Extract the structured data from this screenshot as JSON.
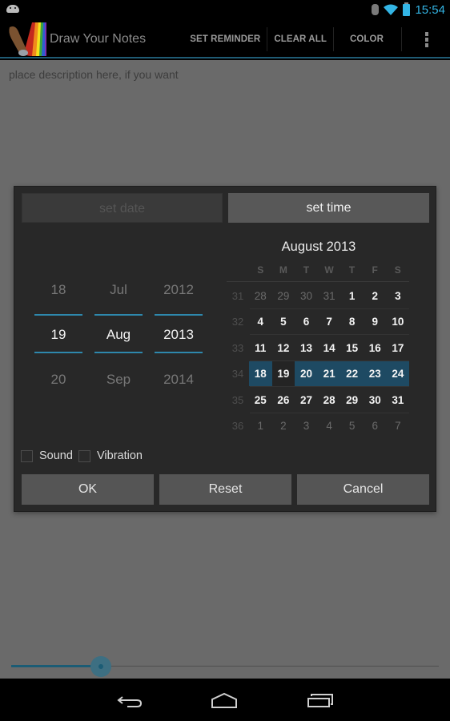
{
  "status_bar": {
    "time": "15:54",
    "icons": [
      "android-notification-icon",
      "bluetooth-icon",
      "wifi-icon",
      "battery-charging-icon"
    ]
  },
  "action_bar": {
    "app_title": "Draw Your Notes",
    "actions": [
      {
        "label": "SET REMINDER"
      },
      {
        "label": "CLEAR ALL"
      },
      {
        "label": "COLOR"
      }
    ],
    "overflow_icon": "overflow-menu-icon"
  },
  "content": {
    "description_placeholder": "place description here, if you want",
    "brush_slider": {
      "value_fraction": 0.21
    }
  },
  "dialog": {
    "tabs": {
      "set_date": "set date",
      "set_time": "set time"
    },
    "date_picker": {
      "day": {
        "prev": "18",
        "current": "19",
        "next": "20"
      },
      "month": {
        "prev": "Jul",
        "current": "Aug",
        "next": "Sep"
      },
      "year": {
        "prev": "2012",
        "current": "2013",
        "next": "2014"
      }
    },
    "calendar": {
      "title": "August 2013",
      "weekdays": [
        "S",
        "M",
        "T",
        "W",
        "T",
        "F",
        "S"
      ],
      "weeks": [
        {
          "week": "31",
          "days": [
            "28",
            "29",
            "30",
            "31",
            "1",
            "2",
            "3"
          ]
        },
        {
          "week": "32",
          "days": [
            "4",
            "5",
            "6",
            "7",
            "8",
            "9",
            "10"
          ]
        },
        {
          "week": "33",
          "days": [
            "11",
            "12",
            "13",
            "14",
            "15",
            "16",
            "17"
          ]
        },
        {
          "week": "34",
          "days": [
            "18",
            "19",
            "20",
            "21",
            "22",
            "23",
            "24"
          ]
        },
        {
          "week": "35",
          "days": [
            "25",
            "26",
            "27",
            "28",
            "29",
            "30",
            "31"
          ]
        },
        {
          "week": "36",
          "days": [
            "1",
            "2",
            "3",
            "4",
            "5",
            "6",
            "7"
          ]
        }
      ],
      "selected_week": "34",
      "selected_day": "19",
      "accent_color": "#1e4a63"
    },
    "checkboxes": [
      {
        "label": "Sound",
        "checked": false
      },
      {
        "label": "Vibration",
        "checked": false
      }
    ],
    "buttons": {
      "ok": "OK",
      "reset": "Reset",
      "cancel": "Cancel"
    }
  },
  "nav_bar": {
    "buttons": [
      "back-icon",
      "home-icon",
      "recent-apps-icon"
    ]
  },
  "colors": {
    "accent": "#33b5e5",
    "picker_line": "#2e88ad",
    "selected_week": "#1e4a63"
  }
}
